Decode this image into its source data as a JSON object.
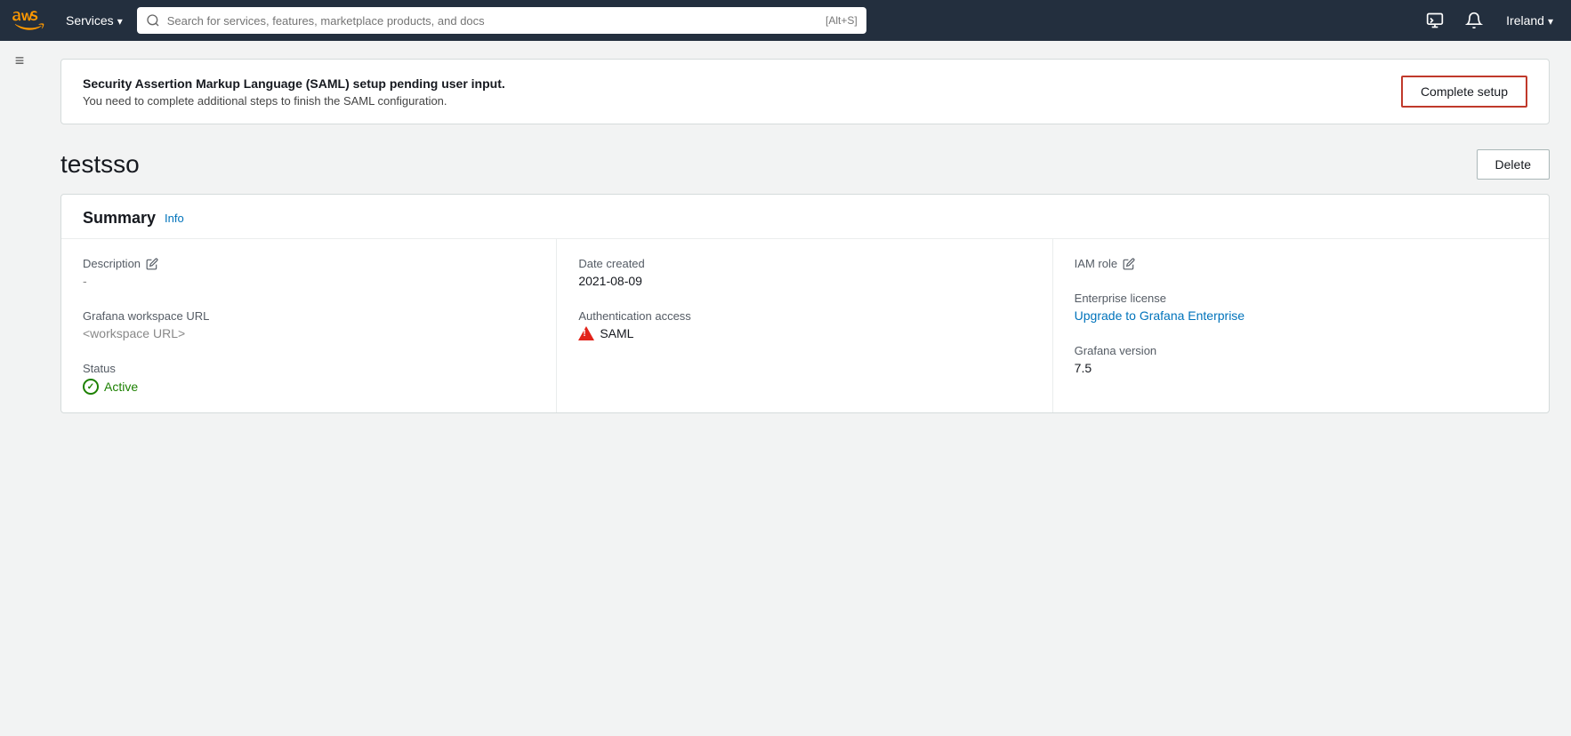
{
  "nav": {
    "services_label": "Services",
    "search_placeholder": "Search for services, features, marketplace products, and docs",
    "search_shortcut": "[Alt+S]",
    "region_label": "Ireland"
  },
  "banner": {
    "title": "Security Assertion Markup Language (SAML) setup pending user input.",
    "subtitle": "You need to complete additional steps to finish the SAML configuration.",
    "complete_setup_label": "Complete setup"
  },
  "page": {
    "workspace_name": "testsso",
    "delete_label": "Delete"
  },
  "summary": {
    "title": "Summary",
    "info_label": "Info",
    "description_label": "Description",
    "description_value": "-",
    "grafana_url_label": "Grafana workspace URL",
    "grafana_url_value": "<workspace URL>",
    "status_label": "Status",
    "status_value": "Active",
    "date_created_label": "Date created",
    "date_created_value": "2021-08-09",
    "auth_access_label": "Authentication access",
    "auth_access_value": "SAML",
    "iam_role_label": "IAM role",
    "enterprise_license_label": "Enterprise license",
    "enterprise_license_value": "Upgrade to Grafana Enterprise",
    "grafana_version_label": "Grafana version",
    "grafana_version_value": "7.5"
  }
}
